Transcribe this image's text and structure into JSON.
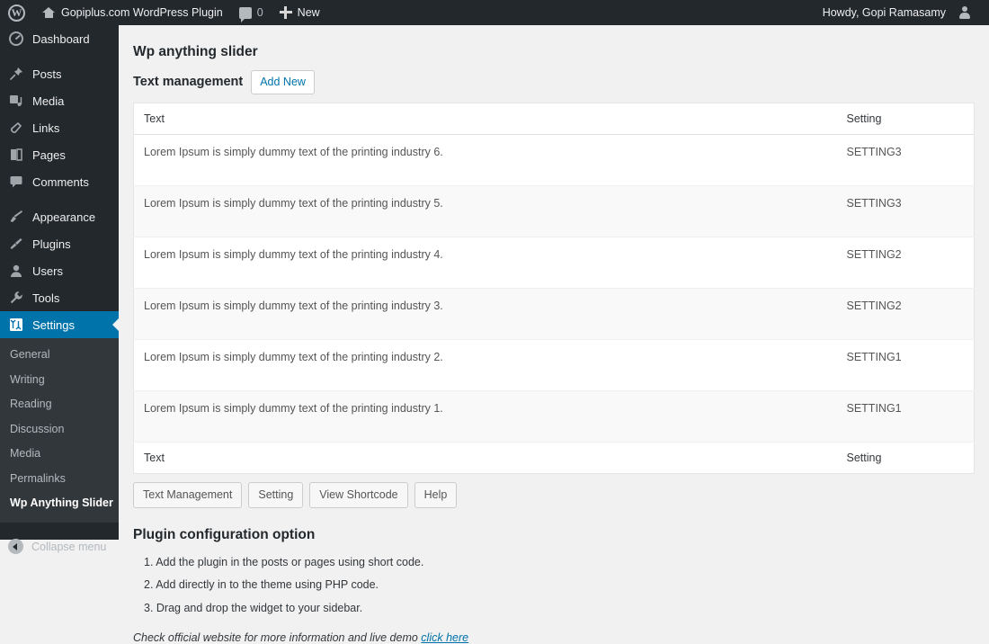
{
  "adminbar": {
    "logo_icon": "wordpress-logo-icon",
    "home_icon": "home-icon",
    "site_name": "Gopiplus.com WordPress Plugin",
    "comments_icon": "comment-bubble-icon",
    "comments_count": "0",
    "new_icon": "plus-icon",
    "new_label": "New",
    "howdy": "Howdy, Gopi Ramasamy",
    "avatar_icon": "avatar-icon"
  },
  "sidebar": {
    "items": [
      {
        "label": "Dashboard",
        "icon": "dashboard-gauge-icon"
      },
      {
        "label": "Posts",
        "icon": "pin-icon"
      },
      {
        "label": "Media",
        "icon": "media-icon"
      },
      {
        "label": "Links",
        "icon": "link-chain-icon"
      },
      {
        "label": "Pages",
        "icon": "pages-icon"
      },
      {
        "label": "Comments",
        "icon": "comment-bubble-icon"
      },
      {
        "label": "Appearance",
        "icon": "paintbrush-icon"
      },
      {
        "label": "Plugins",
        "icon": "plug-icon"
      },
      {
        "label": "Users",
        "icon": "user-icon"
      },
      {
        "label": "Tools",
        "icon": "wrench-icon"
      },
      {
        "label": "Settings",
        "icon": "settings-sliders-icon"
      }
    ],
    "submenu": [
      {
        "label": "General",
        "active": false
      },
      {
        "label": "Writing",
        "active": false
      },
      {
        "label": "Reading",
        "active": false
      },
      {
        "label": "Discussion",
        "active": false
      },
      {
        "label": "Media",
        "active": false
      },
      {
        "label": "Permalinks",
        "active": false
      },
      {
        "label": "Wp Anything Slider",
        "active": true
      }
    ],
    "collapse_label": "Collapse menu",
    "collapse_icon": "collapse-arrow-icon",
    "accent_color": "#0073aa",
    "background_color": "#23282d",
    "submenu_background_color": "#32373c"
  },
  "main": {
    "page_title": "Wp anything slider",
    "subtitle": "Text management",
    "add_new_label": "Add New",
    "table": {
      "headers": [
        "Text",
        "Setting"
      ],
      "footers": [
        "Text",
        "Setting"
      ],
      "rows": [
        {
          "text": "Lorem Ipsum is simply dummy text of the printing industry 6.",
          "setting": "SETTING3"
        },
        {
          "text": "Lorem Ipsum is simply dummy text of the printing industry 5.",
          "setting": "SETTING3"
        },
        {
          "text": "Lorem Ipsum is simply dummy text of the printing industry 4.",
          "setting": "SETTING2"
        },
        {
          "text": "Lorem Ipsum is simply dummy text of the printing industry 3.",
          "setting": "SETTING2"
        },
        {
          "text": "Lorem Ipsum is simply dummy text of the printing industry 2.",
          "setting": "SETTING1"
        },
        {
          "text": "Lorem Ipsum is simply dummy text of the printing industry 1.",
          "setting": "SETTING1"
        }
      ]
    },
    "buttons": [
      {
        "label": "Text Management"
      },
      {
        "label": "Setting"
      },
      {
        "label": "View Shortcode"
      },
      {
        "label": "Help"
      }
    ],
    "config_title": "Plugin configuration option",
    "config_items": [
      "1. Add the plugin in the posts or pages using short code.",
      "2. Add directly in to the theme using PHP code.",
      "3. Drag and drop the widget to your sidebar."
    ],
    "config_note_text": "Check official website for more information and live demo ",
    "config_note_link": "click here"
  }
}
